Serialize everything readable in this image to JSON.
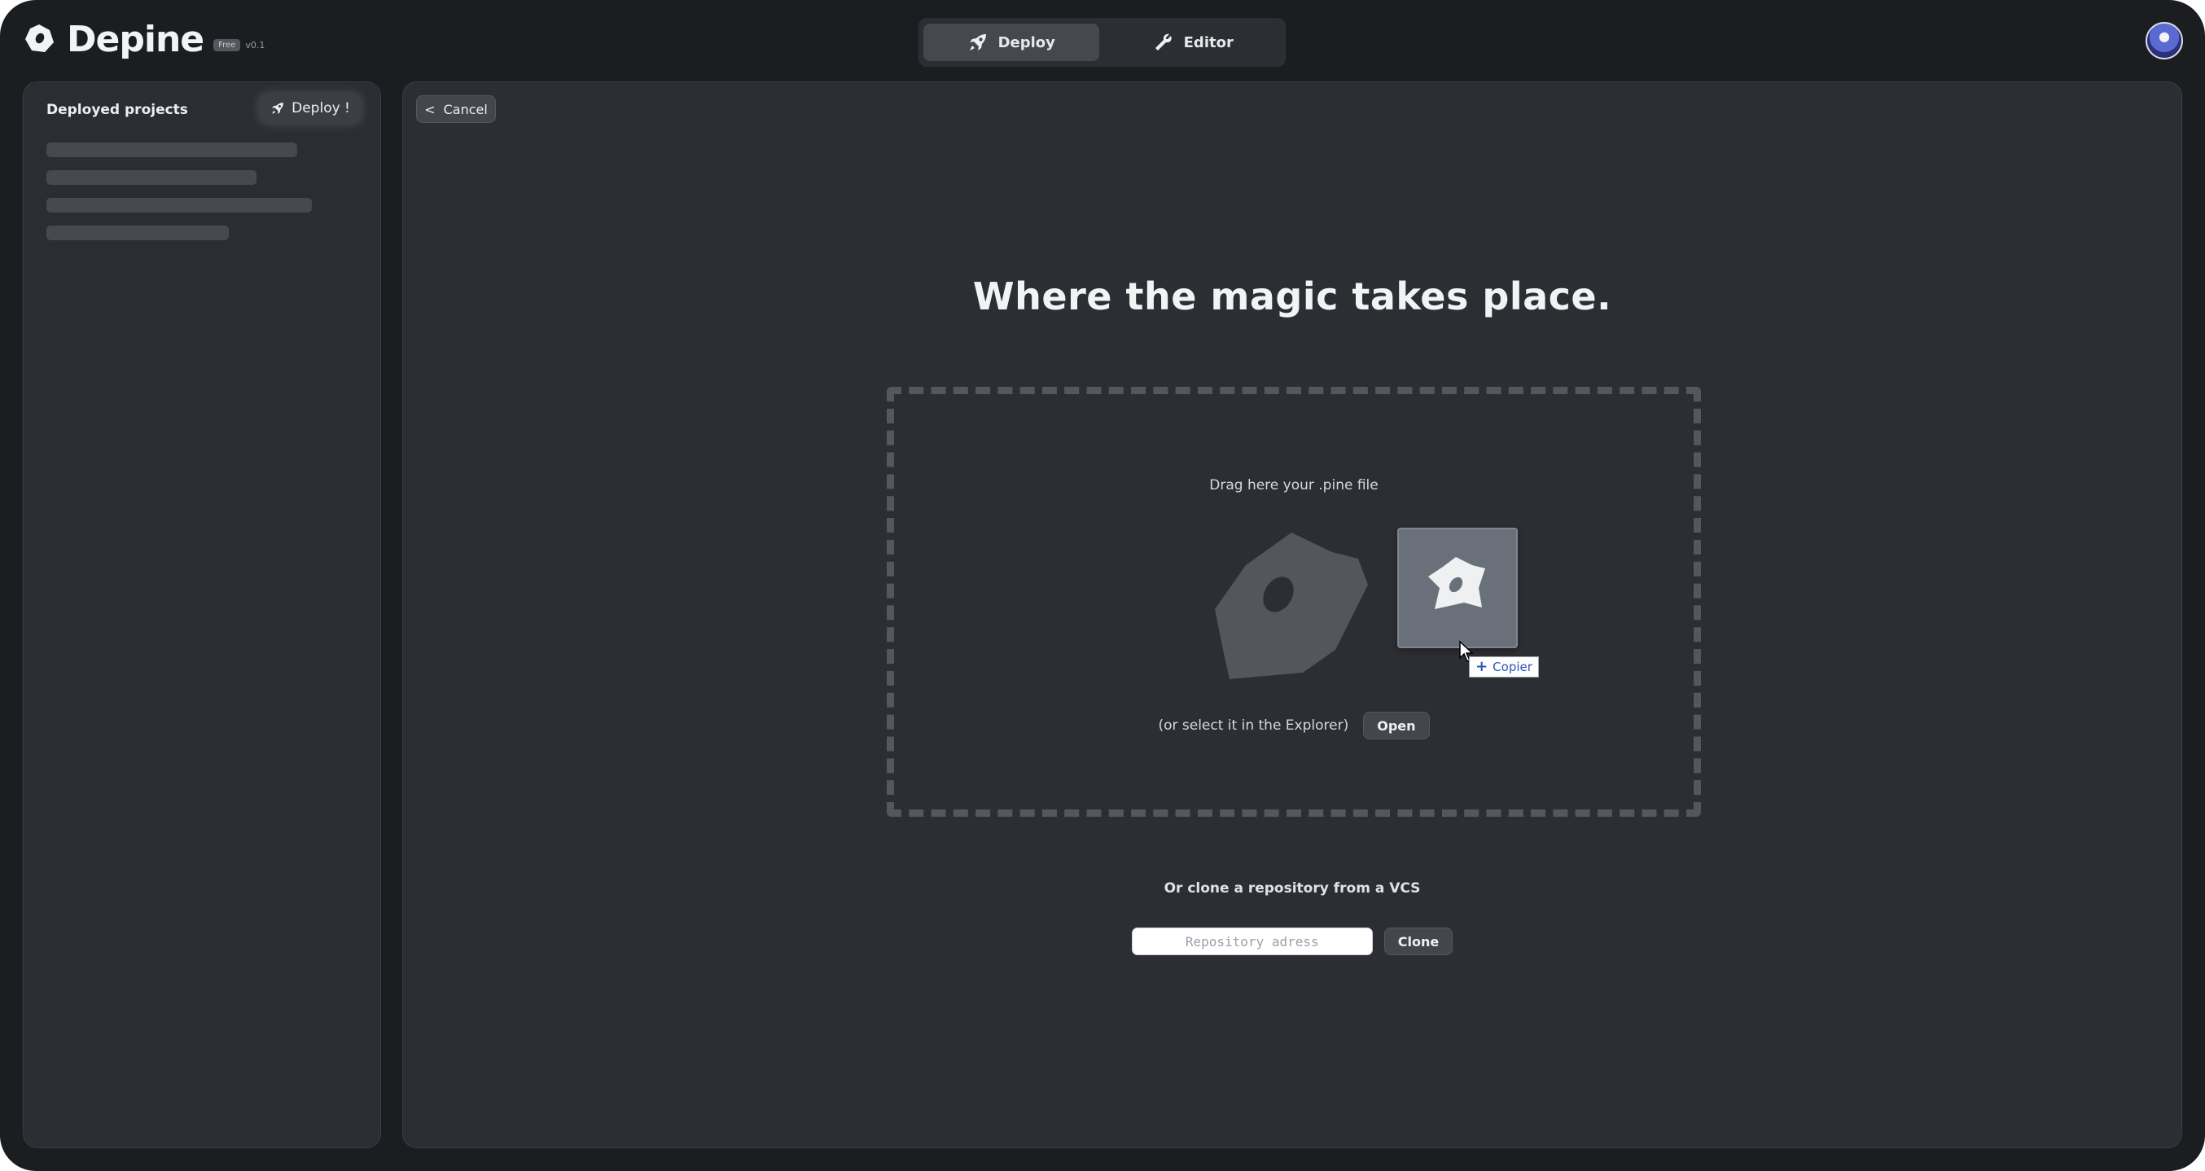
{
  "app": {
    "name": "Depine",
    "badge": "Free",
    "version": "v0.1"
  },
  "topnav": {
    "tabs": [
      {
        "label": "Deploy",
        "icon": "rocket-icon",
        "active": true
      },
      {
        "label": "Editor",
        "icon": "wrench-icon",
        "active": false
      }
    ]
  },
  "sidebar": {
    "title": "Deployed projects",
    "deploy_label": "Deploy !"
  },
  "main": {
    "cancel_label": "Cancel",
    "cancel_icon": "<",
    "title": "Where the magic takes place.",
    "drop_label": "Drag here your .pine file",
    "explorer_text": "(or select it in the Explorer)",
    "open_label": "Open",
    "copier_label": "Copier",
    "vcs_label": "Or clone a repository from a VCS",
    "repo_placeholder": "Repository adress",
    "clone_label": "Clone"
  },
  "colors": {
    "window_bg": "#1c1d21",
    "panel_bg": "#2d2e33",
    "accent_link": "#2b56b8"
  }
}
